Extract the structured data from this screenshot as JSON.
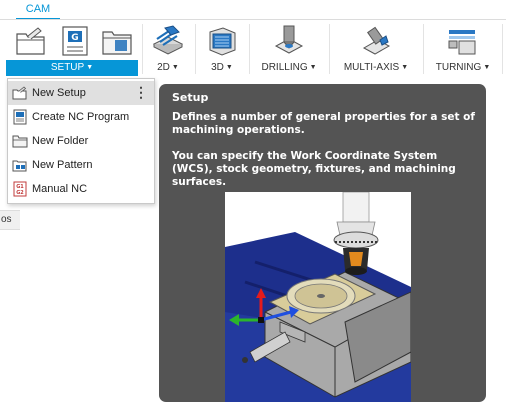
{
  "tabs": {
    "active": "CAM"
  },
  "ribbon": {
    "groups": [
      {
        "label": "SETUP"
      },
      {
        "label": "2D"
      },
      {
        "label": "3D"
      },
      {
        "label": "DRILLING"
      },
      {
        "label": "MULTI-AXIS"
      },
      {
        "label": "TURNING"
      }
    ],
    "caret": "▼"
  },
  "browser": {
    "stub_text": "os"
  },
  "menu": {
    "items": [
      {
        "label": "New Setup",
        "icon": "new-setup-icon",
        "highlighted": true
      },
      {
        "label": "Create NC Program",
        "icon": "nc-program-icon"
      },
      {
        "label": "New Folder",
        "icon": "folder-icon"
      },
      {
        "label": "New Pattern",
        "icon": "pattern-icon"
      },
      {
        "label": "Manual NC",
        "icon": "manual-nc-icon"
      }
    ],
    "more": "⋮"
  },
  "tooltip": {
    "title": "Setup",
    "para1": "Defines a number of general properties for a set of machining operations.",
    "para2": "You can specify the Work Coordinate System (WCS), stock geometry, fixtures, and machining surfaces."
  },
  "colors": {
    "accent": "#0696d7",
    "tooltip_bg": "#545454"
  }
}
